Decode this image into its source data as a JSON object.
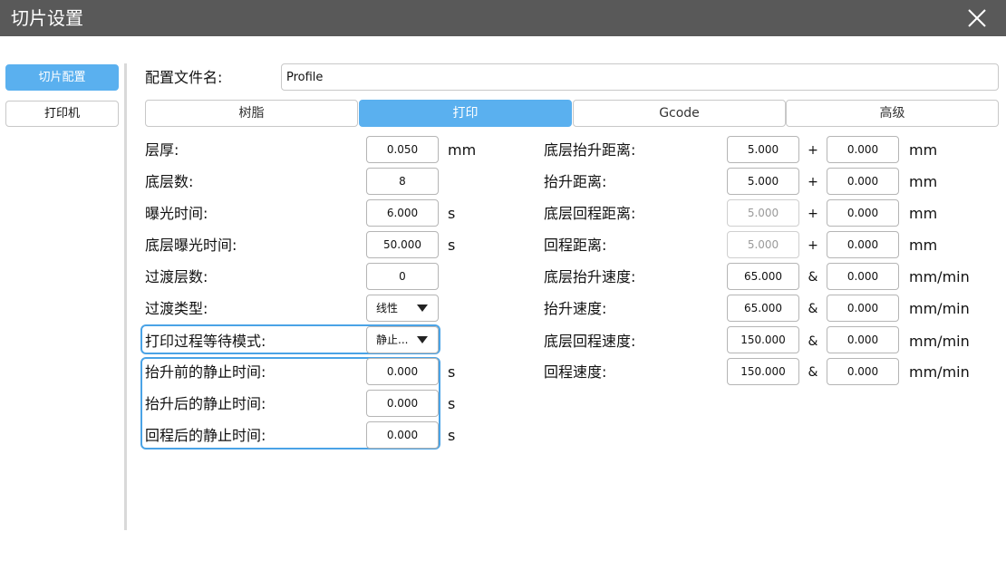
{
  "window": {
    "title": "切片设置"
  },
  "sidebar": {
    "items": [
      {
        "label": "切片配置"
      },
      {
        "label": "打印机"
      }
    ]
  },
  "profile": {
    "label": "配置文件名:",
    "value": "Profile"
  },
  "tabs": [
    {
      "label": "树脂"
    },
    {
      "label": "打印"
    },
    {
      "label": "Gcode"
    },
    {
      "label": "高级"
    }
  ],
  "left": {
    "layer_height": {
      "label": "层厚:",
      "value": "0.050",
      "unit": "mm"
    },
    "bottom_layers": {
      "label": "底层数:",
      "value": "8"
    },
    "exposure_time": {
      "label": "曝光时间:",
      "value": "6.000",
      "unit": "s"
    },
    "bottom_exposure_time": {
      "label": "底层曝光时间:",
      "value": "50.000",
      "unit": "s"
    },
    "transition_layers": {
      "label": "过渡层数:",
      "value": "0"
    },
    "transition_type": {
      "label": "过渡类型:",
      "value": "线性"
    },
    "wait_mode": {
      "label": "打印过程等待模式:",
      "value": "静止..."
    },
    "rest_before_lift": {
      "label": "抬升前的静止时间:",
      "value": "0.000",
      "unit": "s"
    },
    "rest_after_lift": {
      "label": "抬升后的静止时间:",
      "value": "0.000",
      "unit": "s"
    },
    "rest_after_retract": {
      "label": "回程后的静止时间:",
      "value": "0.000",
      "unit": "s"
    }
  },
  "right": {
    "bottom_lift_distance": {
      "label": "底层抬升距离:",
      "value1": "5.000",
      "op": "+",
      "value2": "0.000",
      "unit": "mm"
    },
    "lift_distance": {
      "label": "抬升距离:",
      "value1": "5.000",
      "op": "+",
      "value2": "0.000",
      "unit": "mm"
    },
    "bottom_retract_distance": {
      "label": "底层回程距离:",
      "value1": "5.000",
      "op": "+",
      "value2": "0.000",
      "unit": "mm"
    },
    "retract_distance": {
      "label": "回程距离:",
      "value1": "5.000",
      "op": "+",
      "value2": "0.000",
      "unit": "mm"
    },
    "bottom_lift_speed": {
      "label": "底层抬升速度:",
      "value1": "65.000",
      "op": "&",
      "value2": "0.000",
      "unit": "mm/min"
    },
    "lift_speed": {
      "label": "抬升速度:",
      "value1": "65.000",
      "op": "&",
      "value2": "0.000",
      "unit": "mm/min"
    },
    "bottom_retract_speed": {
      "label": "底层回程速度:",
      "value1": "150.000",
      "op": "&",
      "value2": "0.000",
      "unit": "mm/min"
    },
    "retract_speed": {
      "label": "回程速度:",
      "value1": "150.000",
      "op": "&",
      "value2": "0.000",
      "unit": "mm/min"
    }
  },
  "colors": {
    "accent": "#5ab0ef",
    "titlebar": "#595959",
    "highlight_border": "#4aa3e6"
  },
  "icons": {
    "close": "close-icon",
    "dropdown": "chevron-down-icon"
  }
}
